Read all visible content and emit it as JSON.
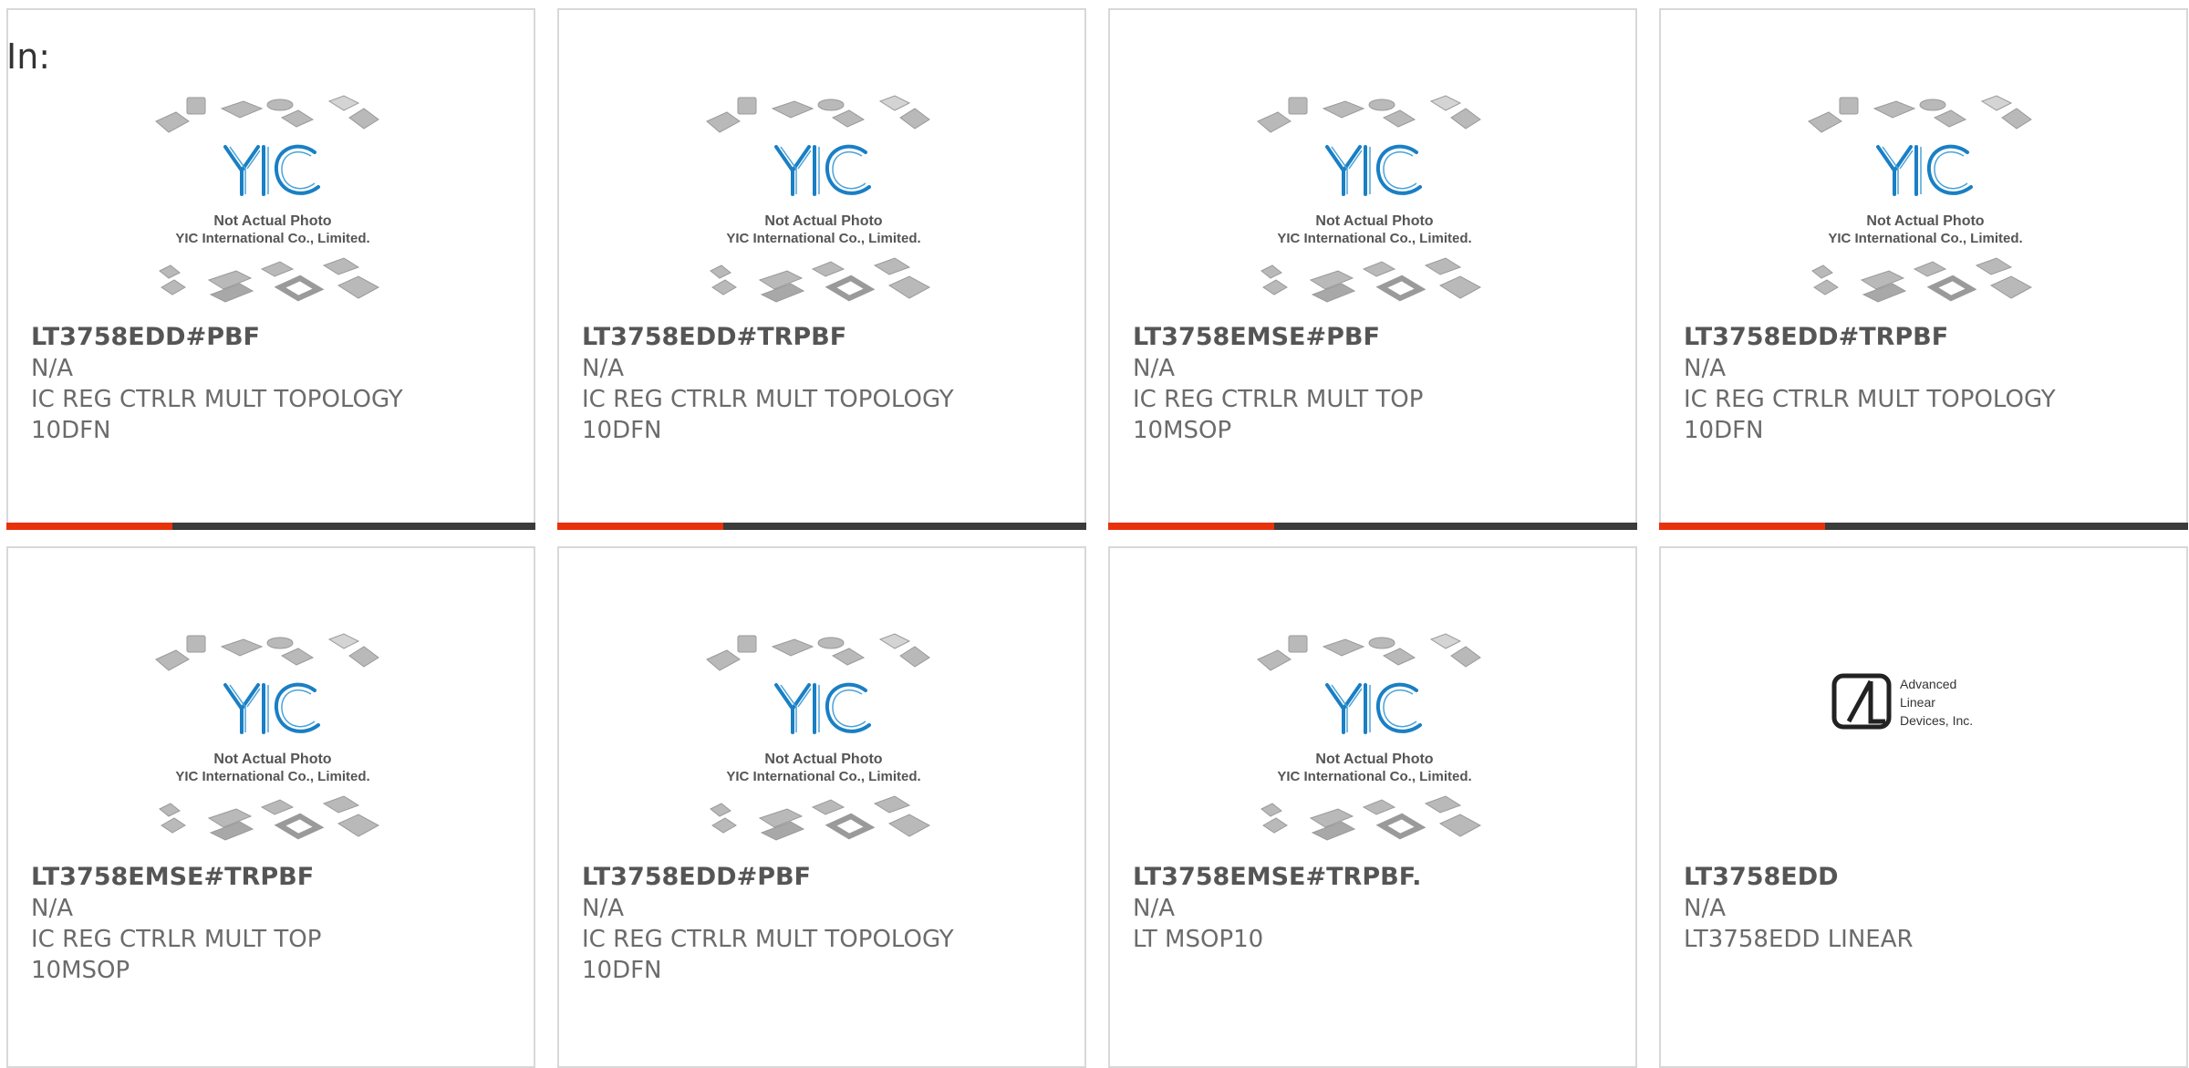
{
  "header": {
    "in_label": "In:"
  },
  "placeholder": {
    "line1": "Not Actual Photo",
    "line2": "YIC International Co., Limited.",
    "logo_text": "YIC"
  },
  "ald_logo": {
    "line1": "Advanced",
    "line2": "Linear",
    "line3": "Devices, Inc."
  },
  "colors": {
    "accent": "#e8320b",
    "bar_dark": "#3b3b3b",
    "logo_blue": "#1a7fc4"
  },
  "products": [
    {
      "part": "LT3758EDD#PBF",
      "manufacturer": "N/A",
      "description": "IC REG CTRLR MULT TOPOLOGY 10DFN",
      "image": "yic-placeholder"
    },
    {
      "part": "LT3758EDD#TRPBF",
      "manufacturer": "N/A",
      "description": "IC REG CTRLR MULT TOPOLOGY 10DFN",
      "image": "yic-placeholder"
    },
    {
      "part": "LT3758EMSE#PBF",
      "manufacturer": "N/A",
      "description": "IC REG CTRLR MULT TOP 10MSOP",
      "image": "yic-placeholder"
    },
    {
      "part": "LT3758EDD#TRPBF",
      "manufacturer": "N/A",
      "description": "IC REG CTRLR MULT TOPOLOGY 10DFN",
      "image": "yic-placeholder"
    },
    {
      "part": "LT3758EMSE#TRPBF",
      "manufacturer": "N/A",
      "description": "IC REG CTRLR MULT TOP 10MSOP",
      "image": "yic-placeholder"
    },
    {
      "part": "LT3758EDD#PBF",
      "manufacturer": "N/A",
      "description": "IC REG CTRLR MULT TOPOLOGY 10DFN",
      "image": "yic-placeholder"
    },
    {
      "part": "LT3758EMSE#TRPBF.",
      "manufacturer": "N/A",
      "description": "LT MSOP10",
      "image": "yic-placeholder"
    },
    {
      "part": "LT3758EDD",
      "manufacturer": "N/A",
      "description": "LT3758EDD LINEAR",
      "image": "ald-logo"
    }
  ]
}
